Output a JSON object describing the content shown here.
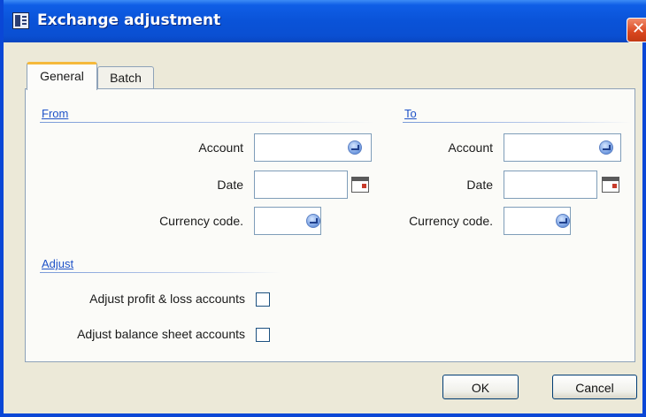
{
  "window": {
    "title": "Exchange adjustment",
    "close_glyph": "✕"
  },
  "tabs": [
    {
      "label": "General",
      "selected": true
    },
    {
      "label": "Batch",
      "selected": false
    }
  ],
  "from": {
    "title": "From",
    "account_label": "Account",
    "account_value": "",
    "date_label": "Date",
    "date_value": "",
    "currency_label": "Currency code.",
    "currency_value": ""
  },
  "to": {
    "title": "To",
    "account_label": "Account",
    "account_value": "",
    "date_label": "Date",
    "date_value": "",
    "currency_label": "Currency code.",
    "currency_value": ""
  },
  "adjust": {
    "title": "Adjust",
    "profit_loss_label": "Adjust profit & loss accounts",
    "profit_loss_checked": false,
    "balance_sheet_label": "Adjust balance sheet accounts",
    "balance_sheet_checked": false
  },
  "buttons": {
    "ok_label": "OK",
    "cancel_label": "Cancel"
  },
  "icons": {
    "window": "window-app-icon",
    "lookup": "lookup-arrow-icon",
    "calendar": "calendar-icon"
  },
  "colors": {
    "titlebar": "#0a53d8",
    "section_title": "#1e52c8",
    "close_button": "#d9461f",
    "active_tab_accent": "#f5b93b"
  }
}
